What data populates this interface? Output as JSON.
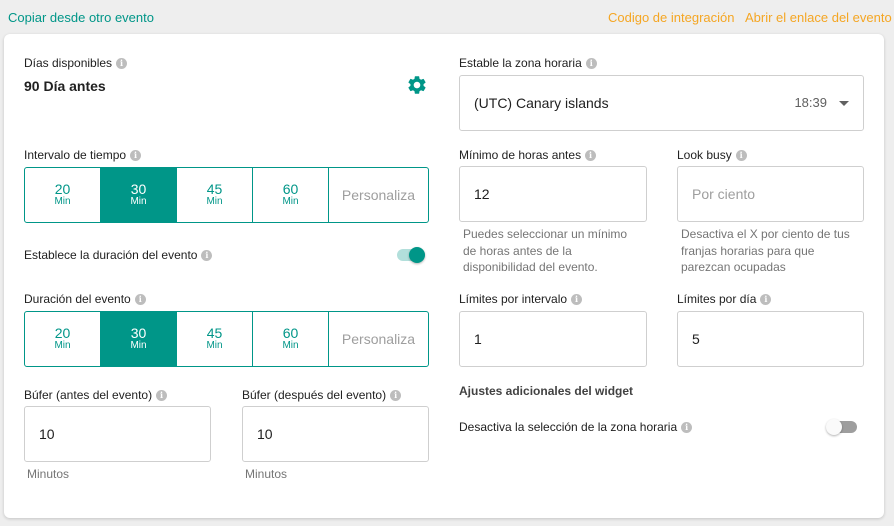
{
  "header": {
    "copy_link": "Copiar desde otro evento",
    "integration_link": "Codigo de integración",
    "open_link": "Abrir el enlace del evento"
  },
  "available_days": {
    "label": "Días disponibles",
    "value": "90 Día antes"
  },
  "timezone": {
    "label": "Estable la zona horaria",
    "value": "(UTC) Canary islands",
    "time": "18:39"
  },
  "time_interval": {
    "label": "Intervalo de tiempo",
    "options": [
      {
        "num": "20",
        "unit": "Min"
      },
      {
        "num": "30",
        "unit": "Min"
      },
      {
        "num": "45",
        "unit": "Min"
      },
      {
        "num": "60",
        "unit": "Min"
      }
    ],
    "custom": "Personaliza"
  },
  "min_hours": {
    "label": "Mínimo de horas antes",
    "value": "12",
    "hint": "Puedes seleccionar un mínimo de horas antes de la disponibilidad del evento."
  },
  "look_busy": {
    "label": "Look busy",
    "placeholder": "Por ciento",
    "hint": "Desactiva el X por ciento de tus franjas horarias para que parezcan ocupadas"
  },
  "set_duration": {
    "label": "Establece la duración del evento",
    "enabled": true
  },
  "event_duration": {
    "label": "Duración del evento",
    "options": [
      {
        "num": "20",
        "unit": "Min"
      },
      {
        "num": "30",
        "unit": "Min"
      },
      {
        "num": "45",
        "unit": "Min"
      },
      {
        "num": "60",
        "unit": "Min"
      }
    ],
    "custom": "Personaliza"
  },
  "limit_interval": {
    "label": "Límites por intervalo",
    "value": "1"
  },
  "limit_day": {
    "label": "Límites por día",
    "value": "5"
  },
  "widget_settings": {
    "title": "Ajustes adicionales del widget"
  },
  "disable_timezone": {
    "label": "Desactiva la selección de la zona horaria",
    "enabled": false
  },
  "buffer_before": {
    "label": "Búfer (antes del evento)",
    "value": "10",
    "unit": "Minutos"
  },
  "buffer_after": {
    "label": "Búfer (después del evento)",
    "value": "10",
    "unit": "Minutos"
  },
  "colors": {
    "accent": "#009688",
    "link_orange": "#f5a623"
  }
}
